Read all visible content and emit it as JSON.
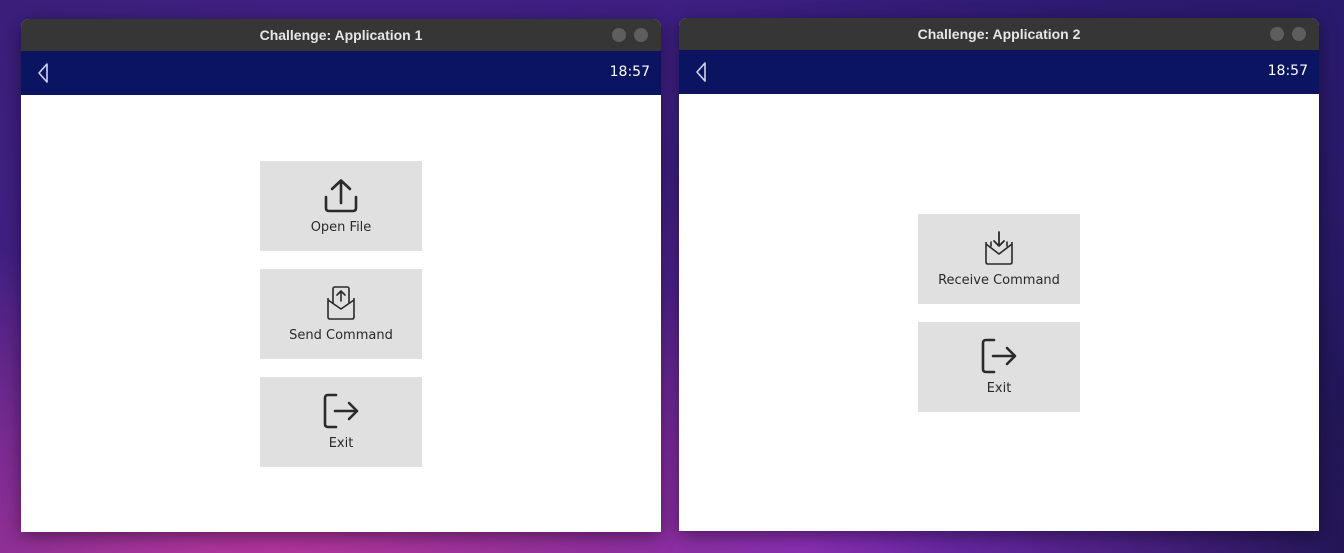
{
  "windows": [
    {
      "title": "Challenge: Application 1",
      "time": "18:57",
      "buttons": [
        {
          "label": "Open File",
          "icon": "upload-icon"
        },
        {
          "label": "Send Command",
          "icon": "send-envelope-icon"
        },
        {
          "label": "Exit",
          "icon": "exit-icon"
        }
      ]
    },
    {
      "title": "Challenge: Application 2",
      "time": "18:57",
      "buttons": [
        {
          "label": "Receive Command",
          "icon": "receive-envelope-icon"
        },
        {
          "label": "Exit",
          "icon": "exit-icon"
        }
      ]
    }
  ],
  "colors": {
    "titlebar": "#363636",
    "appbar": "#0b1460",
    "tile": "#e0e0e0",
    "icon": "#2a2a2a"
  }
}
